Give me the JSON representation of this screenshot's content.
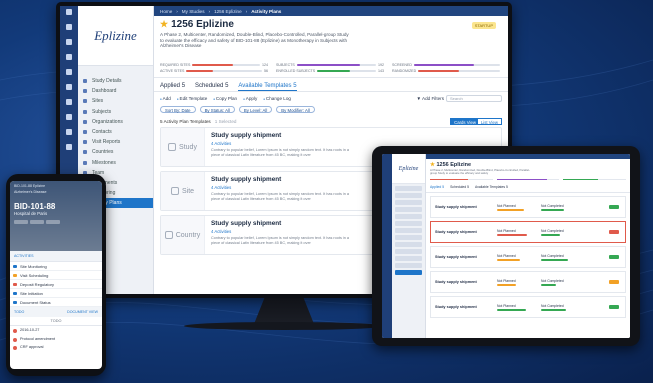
{
  "monitor": {
    "breadcrumb": [
      "Home",
      "My Studies",
      "1256 Eplizine",
      "Activity Plans"
    ],
    "logo_text": "Eplizine",
    "nav": [
      "Study Details",
      "Dashboard",
      "Sites",
      "Subjects",
      "Organizations",
      "Contacts",
      "Visit Reports",
      "Countries",
      "Milestones",
      "Team",
      "Documents",
      "Monitoring",
      "Activity Plans"
    ],
    "study": {
      "title": "1256 Eplizine",
      "badge": "STARTUP",
      "description": "A Phase 2, Multicenter, Randomized, Double-Blind, Placebo-Controlled, Parallel-group Study to evaluate the efficacy and safety of BID-101-88 (Eplizine) as Monotherapy in Subjects with Alzheimer's Disease",
      "metrics": [
        {
          "label": "REQUIRED SITES",
          "value": "124",
          "fill": 0.6,
          "color": "#e05a4b"
        },
        {
          "label": "ACTIVE SITES",
          "value": "56",
          "fill": 0.35,
          "color": "#e05a4b"
        },
        {
          "label": "SUBJECTS",
          "value": "192",
          "fill": 0.8,
          "color": "#8c4fc7"
        },
        {
          "label": "ENROLLED SUBJECTS",
          "value": "143",
          "fill": 0.55,
          "color": "#35a853"
        },
        {
          "label": "SCREENED",
          "value": "",
          "fill": 0.7,
          "color": "#8c4fc7"
        },
        {
          "label": "RANDOMIZED",
          "value": "",
          "fill": 0.5,
          "color": "#e05a4b"
        }
      ]
    },
    "tabs": [
      {
        "label": "Applied",
        "count": "5"
      },
      {
        "label": "Scheduled",
        "count": "5"
      },
      {
        "label": "Available Templates",
        "count": "5"
      }
    ],
    "toolbar": [
      "Add",
      "Edit Template",
      "Copy Plan",
      "Apply",
      "Change Log"
    ],
    "add_filters": "Add Filters",
    "search_placeholder": "Search",
    "pills": [
      "Sort By: Date",
      "By Status: All",
      "By Level: All",
      "By Modifier: All"
    ],
    "count_text": "5 Activity Plan Templates",
    "selected_text": "1 Selected",
    "cards_view": "Cards View",
    "list_view": "List View",
    "cards": [
      {
        "type": "Study",
        "title": "Study supply shipment",
        "sub": "4 Activities",
        "text": "Contrary to popular belief, Lorem Ipsum is not simply random text. It has roots in a piece of classical Latin literature from 45 BC, making it over"
      },
      {
        "type": "Site",
        "title": "Study supply shipment",
        "sub": "4 Activities",
        "text": "Contrary to popular belief, Lorem Ipsum is not simply random text. It has roots in a piece of classical Latin literature from 45 BC, making it over"
      },
      {
        "type": "Country",
        "title": "Study supply shipment",
        "sub": "4 Activities",
        "text": "Contrary to popular belief, Lorem Ipsum is not simply random text. It has roots in a piece of classical Latin literature from 45 BC, making it over"
      }
    ]
  },
  "tablet": {
    "logo_text": "Eplizine",
    "title": "1256 Eplizine",
    "description": "A Phase 2, Multicenter, Randomized, Double-Blind, Placebo-Controlled, Parallel-group Study to evaluate the efficacy and safety",
    "tabs": [
      "Applied 5",
      "Scheduled 5",
      "Available Templates 5"
    ],
    "rows": [
      {
        "title": "Study supply shipment",
        "status_a": "Not Planned",
        "status_b": "Not Completed",
        "chip_color": "#35a853"
      },
      {
        "title": "Study supply shipment",
        "status_a": "Not Planned",
        "status_b": "Not Completed",
        "chip_color": "#e05a4b"
      },
      {
        "title": "Study supply shipment",
        "status_a": "Not Planned",
        "status_b": "Not Completed",
        "chip_color": "#35a853"
      },
      {
        "title": "Study supply shipment",
        "status_a": "Not Planned",
        "status_b": "Not Completed",
        "chip_color": "#f2a126"
      },
      {
        "title": "Study supply shipment",
        "status_a": "Not Planned",
        "status_b": "Not Completed",
        "chip_color": "#35a853"
      }
    ]
  },
  "phone": {
    "status_bar": "BID-101-88 Eplizine",
    "study_small": "Alzheimer's Disease",
    "subject_id": "BID-101-88",
    "site_name": "Hospital de Paris",
    "section_label": "ACTIVITIES",
    "items": [
      "Site Monitoring",
      "Visit Scheduling",
      "Deposit Regulatory",
      "Site Initiation",
      "Document Status"
    ],
    "subsection_left": "TODO",
    "subsection_right": "DOCUMENT VIEW",
    "todo_label": "TODO",
    "todo_items": [
      "2016-10-27",
      "Protocol amendment",
      "CRF approval"
    ]
  }
}
